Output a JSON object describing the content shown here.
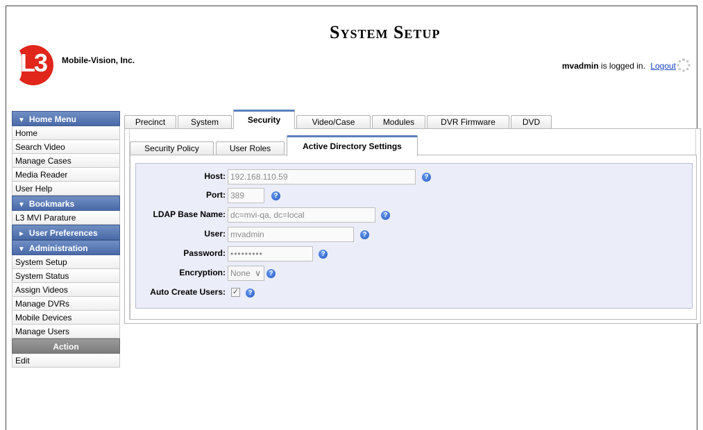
{
  "header": {
    "title": "System Setup",
    "company": "Mobile-Vision, Inc.",
    "logo_text": "L3",
    "username": "mvadmin",
    "logged_in_suffix": " is logged in.",
    "logout_label": "Logout"
  },
  "sidebar": {
    "home_menu": {
      "title": "Home Menu",
      "items": [
        "Home",
        "Search Video",
        "Manage Cases",
        "Media Reader",
        "User Help"
      ]
    },
    "bookmarks": {
      "title": "Bookmarks",
      "items": [
        "L3 MVI Parature"
      ]
    },
    "user_preferences": {
      "title": "User Preferences"
    },
    "administration": {
      "title": "Administration",
      "items": [
        "System Setup",
        "System Status",
        "Assign Videos",
        "Manage DVRs",
        "Mobile Devices",
        "Manage Users"
      ]
    },
    "action": {
      "title": "Action",
      "items": [
        "Edit"
      ]
    }
  },
  "tabs": [
    "Precinct",
    "System",
    "Security",
    "Video/Case",
    "Modules",
    "DVR Firmware",
    "DVD"
  ],
  "active_tab": "Security",
  "subtabs": [
    "Security Policy",
    "User Roles",
    "Active Directory Settings"
  ],
  "active_subtab": "Active Directory Settings",
  "form": {
    "host": {
      "label": "Host:",
      "value": "192.168.110.59"
    },
    "port": {
      "label": "Port:",
      "value": "389"
    },
    "ldap_base_name": {
      "label": "LDAP Base Name:",
      "value": "dc=mvi-qa, dc=local"
    },
    "user": {
      "label": "User:",
      "value": "mvadmin"
    },
    "password": {
      "label": "Password:",
      "value": "•••••••••"
    },
    "encryption": {
      "label": "Encryption:",
      "value": "None"
    },
    "auto_create_users": {
      "label": "Auto Create Users:",
      "checked": true
    }
  },
  "colors": {
    "menu_header": "#5677b3",
    "tab_accent": "#5b7fbd",
    "form_bg": "#ebedf8",
    "logo_red": "#e1261c",
    "link": "#1a45c4"
  }
}
